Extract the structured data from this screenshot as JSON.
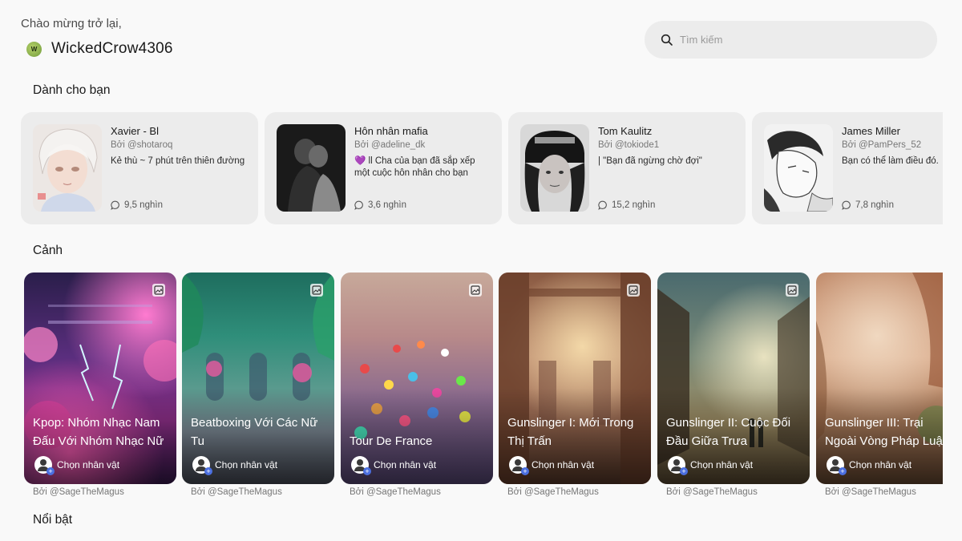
{
  "header": {
    "greeting": "Chào mừng trở lại,",
    "avatar_initial": "W",
    "username": "WickedCrow4306"
  },
  "search": {
    "placeholder": "Tìm kiếm",
    "icon": "search-icon"
  },
  "sections": {
    "for_you": "Dành cho bạn",
    "scenes": "Cảnh",
    "featured": "Nổi bật"
  },
  "for_you_cards": [
    {
      "name": "Xavier - Bl",
      "author": "Bởi @shotaroq",
      "desc": "Kẻ thù ~ 7 phút trên thiên đường",
      "stat": "9,5 nghìn"
    },
    {
      "name": "Hôn nhân mafia",
      "author": "Bởi @adeline_dk",
      "desc": "💜 ll Cha của bạn đã sắp xếp một cuộc hôn nhân cho bạn",
      "stat": "3,6 nghìn"
    },
    {
      "name": "Tom Kaulitz",
      "author": "Bởi @tokiode1",
      "desc": "| \"Bạn đã ngừng chờ đợi\"",
      "stat": "15,2 nghìn"
    },
    {
      "name": "James Miller",
      "author": "Bởi @PamPers_52",
      "desc": "Bạn có thể làm điều đó.",
      "stat": "7,8 nghìn"
    }
  ],
  "scene_cards": [
    {
      "title1": "Kpop: Nhóm Nhạc Nam",
      "title2": "Đấu Với Nhóm Nhạc Nữ",
      "pick": "Chọn nhân vật",
      "author": "Bởi @SageTheMagus"
    },
    {
      "title1": "Beatboxing Với Các Nữ",
      "title2": "Tu",
      "pick": "Chọn nhân vật",
      "author": "Bởi @SageTheMagus"
    },
    {
      "title1": "",
      "title2": "Tour De France",
      "pick": "Chọn nhân vật",
      "author": "Bởi @SageTheMagus"
    },
    {
      "title1": "Gunslinger I: Mới Trong",
      "title2": "Thị Trấn",
      "pick": "Chọn nhân vật",
      "author": "Bởi @SageTheMagus"
    },
    {
      "title1": "Gunslinger II: Cuộc Đối",
      "title2": "Đầu Giữa Trưa",
      "pick": "Chọn nhân vật",
      "author": "Bởi @SageTheMagus"
    },
    {
      "title1": "Gunslinger III: Trại",
      "title2": "Ngoài Vòng Pháp Luật",
      "pick": "Chọn nhân vật",
      "author": "Bởi @SageTheMagus"
    }
  ]
}
